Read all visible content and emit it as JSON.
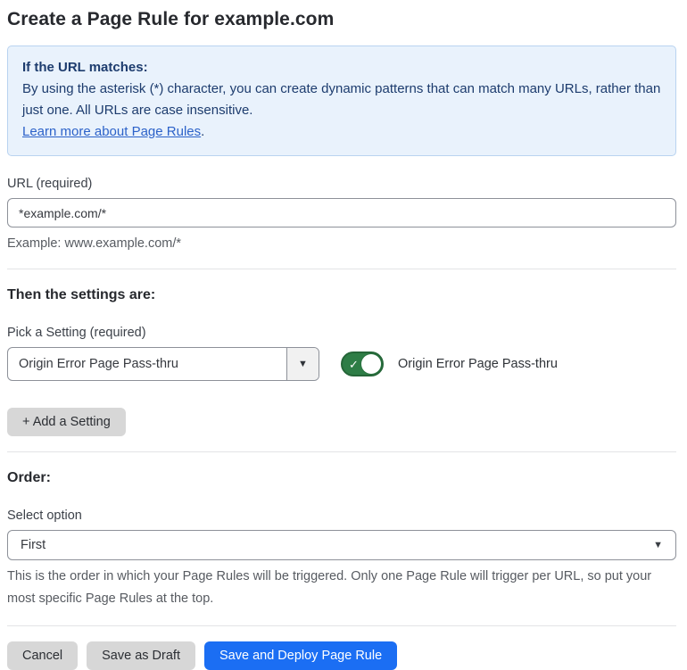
{
  "page": {
    "title": "Create a Page Rule for example.com"
  },
  "info_box": {
    "heading": "If the URL matches:",
    "body": "By using the asterisk (*) character, you can create dynamic patterns that can match many URLs, rather than just one. All URLs are case insensitive.",
    "link_label": "Learn more about Page Rules",
    "link_suffix": "."
  },
  "url_field": {
    "label": "URL (required)",
    "value": "*example.com/*",
    "helper": "Example: www.example.com/*"
  },
  "settings_section": {
    "heading": "Then the settings are:",
    "picker_label": "Pick a Setting (required)",
    "selected_setting": "Origin Error Page Pass-thru",
    "dropdown_caret": "▼",
    "toggle": {
      "state": "on",
      "check_glyph": "✓",
      "label": "Origin Error Page Pass-thru"
    },
    "add_button_label": "+ Add a Setting"
  },
  "order_section": {
    "heading": "Order:",
    "select_label": "Select option",
    "selected_option": "First",
    "dropdown_caret": "▼",
    "helper": "This is the order in which your Page Rules will be triggered. Only one Page Rule will trigger per URL, so put your most specific Page Rules at the top."
  },
  "footer": {
    "cancel_label": "Cancel",
    "save_draft_label": "Save as Draft",
    "save_deploy_label": "Save and Deploy Page Rule"
  },
  "colors": {
    "accent_blue": "#1b6ef3",
    "toggle_green": "#2e7d46",
    "toggle_green_dark": "#256638",
    "info_bg": "#e9f2fc",
    "info_border": "#b9d3f0",
    "info_text": "#1d3c6e",
    "link_blue": "#2c62c9"
  }
}
